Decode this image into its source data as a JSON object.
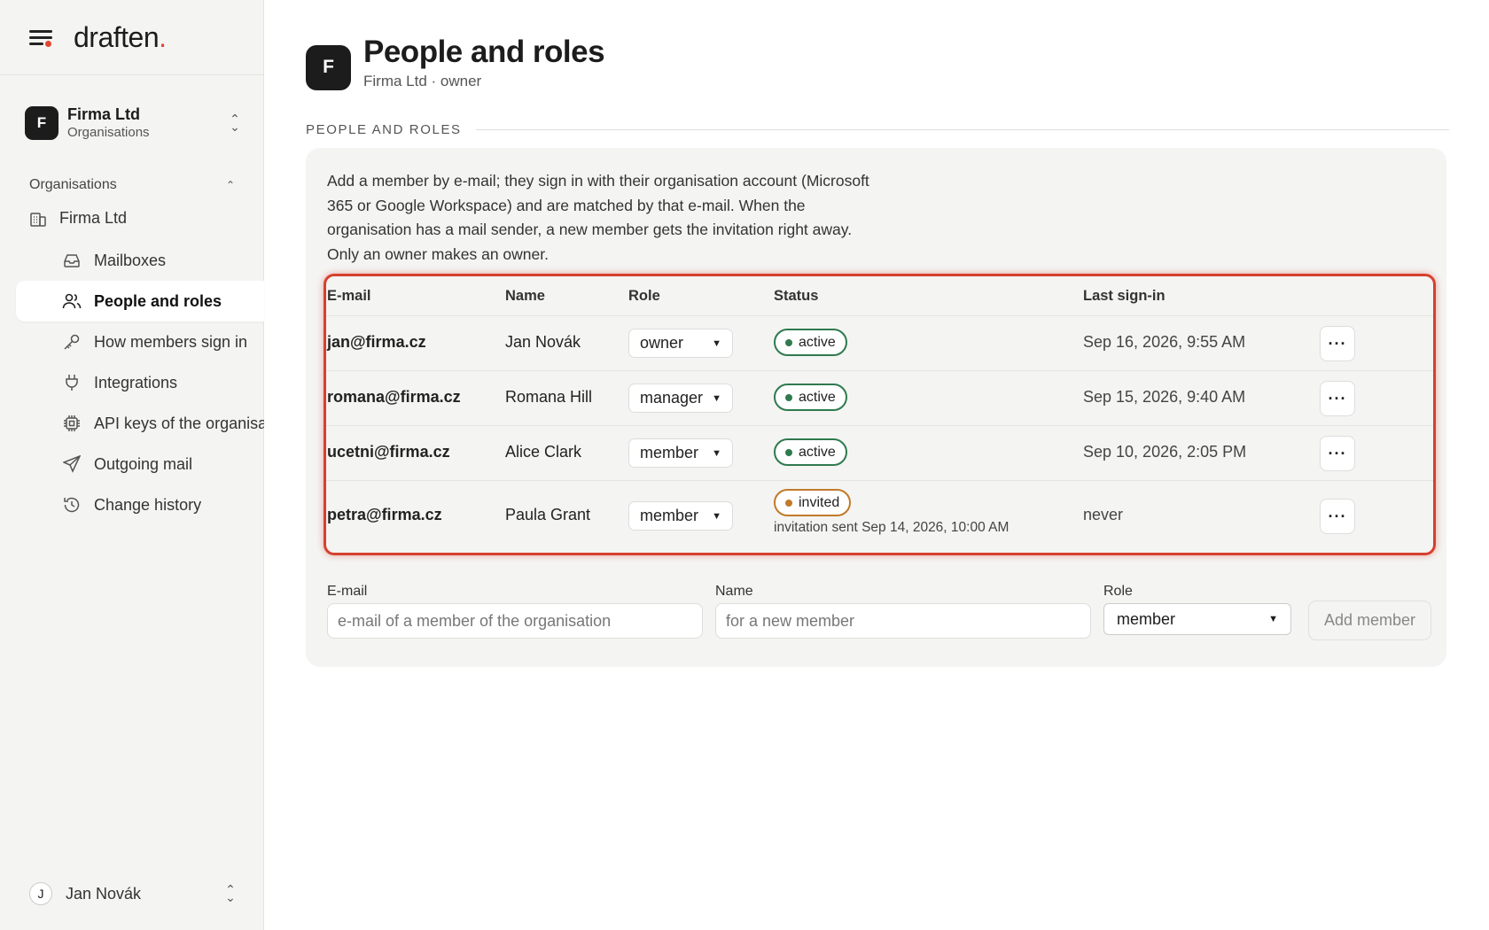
{
  "app": {
    "logo": "draften",
    "logo_dot": "."
  },
  "org_switcher": {
    "initial": "F",
    "name": "Firma Ltd",
    "subtitle": "Organisations"
  },
  "sidebar": {
    "section_title": "Organisations",
    "org_item": "Firma Ltd",
    "items": [
      {
        "label": "Mailboxes",
        "icon": "inbox-icon"
      },
      {
        "label": "People and roles",
        "icon": "users-icon",
        "active": true
      },
      {
        "label": "How members sign in",
        "icon": "key-icon"
      },
      {
        "label": "Integrations",
        "icon": "plug-icon"
      },
      {
        "label": "API keys of the organisation",
        "icon": "chip-icon"
      },
      {
        "label": "Outgoing mail",
        "icon": "send-icon"
      },
      {
        "label": "Change history",
        "icon": "history-icon"
      }
    ]
  },
  "user": {
    "initial": "J",
    "name": "Jan Novák"
  },
  "page": {
    "initial": "F",
    "title": "People and roles",
    "subtitle": "Firma Ltd · owner",
    "section_label": "PEOPLE AND ROLES",
    "description": "Add a member by e-mail; they sign in with their organisation account (Microsoft 365 or Google Workspace) and are matched by that e-mail. When the organisation has a mail sender, a new member gets the invitation right away. Only an owner makes an owner."
  },
  "table": {
    "headers": {
      "email": "E-mail",
      "name": "Name",
      "role": "Role",
      "status": "Status",
      "last_signin": "Last sign-in"
    },
    "rows": [
      {
        "email": "jan@firma.cz",
        "name": "Jan Novák",
        "role": "owner",
        "status": "active",
        "last_signin": "Sep 16, 2026, 9:55 AM",
        "note": ""
      },
      {
        "email": "romana@firma.cz",
        "name": "Romana Hill",
        "role": "manager",
        "status": "active",
        "last_signin": "Sep 15, 2026, 9:40 AM",
        "note": ""
      },
      {
        "email": "ucetni@firma.cz",
        "name": "Alice Clark",
        "role": "member",
        "status": "active",
        "last_signin": "Sep 10, 2026, 2:05 PM",
        "note": ""
      },
      {
        "email": "petra@firma.cz",
        "name": "Paula Grant",
        "role": "member",
        "status": "invited",
        "last_signin": "never",
        "note": "invitation sent Sep 14, 2026, 10:00 AM"
      }
    ],
    "more_label": "···"
  },
  "add_form": {
    "email_label": "E-mail",
    "email_placeholder": "e-mail of a member of the organisation",
    "name_label": "Name",
    "name_placeholder": "for a new member",
    "role_label": "Role",
    "role_value": "member",
    "submit_label": "Add member"
  },
  "colors": {
    "accent": "#e2452f",
    "active": "#2f7a4f",
    "invited": "#c17a2a",
    "highlight": "#d6402e"
  }
}
